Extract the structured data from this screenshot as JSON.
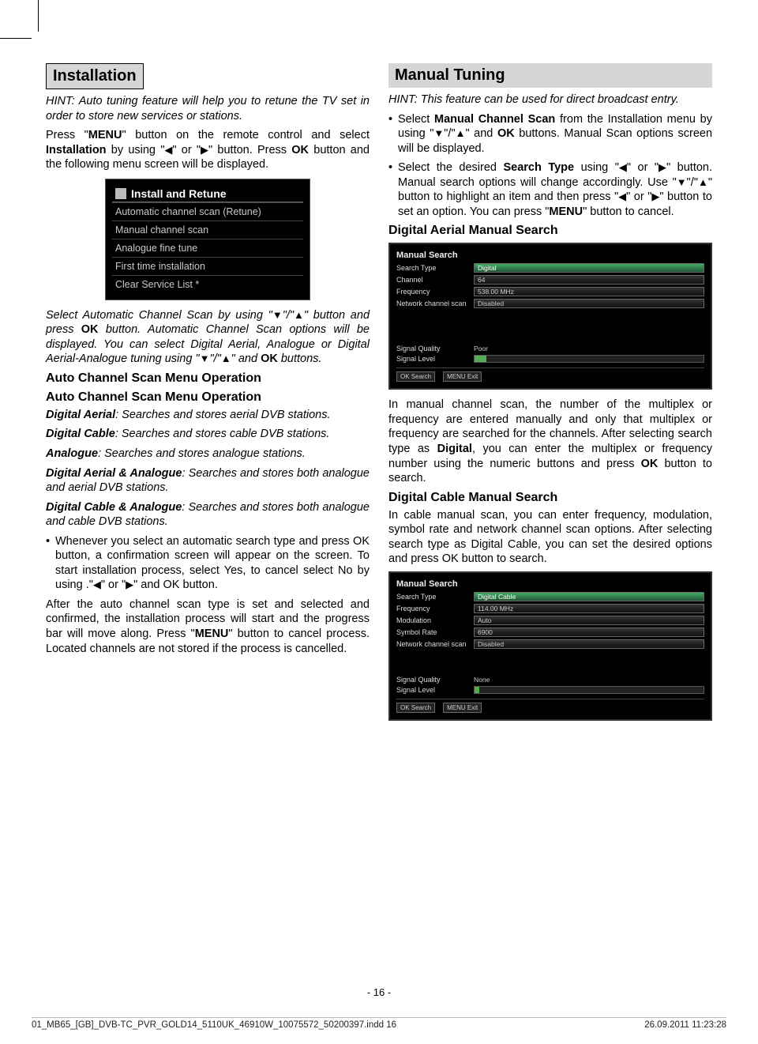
{
  "left": {
    "title": "Installation",
    "hint_pre": "HINT: Auto tuning feature will help you to retune the TV set in order to store new services or stations.",
    "p1_a": "Press \"",
    "p1_b": "MENU",
    "p1_c": "\" button on the remote control and select ",
    "p1_d": "Installation",
    "p1_e": " by using \"",
    "p1_f": "\" or \"",
    "p1_g": "\" button. Press ",
    "p1_h": "OK",
    "p1_i": " button and the following menu screen will be displayed.",
    "menu": {
      "title": "Install and Retune",
      "items": [
        "Automatic channel scan (Retune)",
        "Manual channel scan",
        "Analogue fine tune",
        "First time installation",
        "Clear Service List *"
      ]
    },
    "p2_a": "Select Automatic Channel Scan by using \"",
    "p2_b": "\"/\"",
    "p2_c": "\" button and press ",
    "p2_d": "OK",
    "p2_e": " button. Automatic Channel Scan options will be displayed. You can select Digital Aerial, Analogue or Digital Aerial-Analogue tuning using \"",
    "p2_f": "\"/\"",
    "p2_g": "\" and ",
    "p2_h": "OK",
    "p2_i": " buttons.",
    "sub1": "Auto Channel Scan Menu Operation",
    "sub2": "Auto Channel Scan Menu Operation",
    "da_l": "Digital Aerial",
    "da_t": ": Searches and stores aerial DVB stations.",
    "dc_l": "Digital Cable",
    "dc_t": ": Searches and stores cable DVB stations.",
    "an_l": "Analogue",
    "an_t": ": Searches and stores analogue stations.",
    "daa_l": "Digital Aerial & Analogue",
    "daa_t": ": Searches and stores both analogue and aerial DVB stations.",
    "dca_l": "Digital Cable & Analogue",
    "dca_t": ": Searches and stores both analogue and cable DVB stations.",
    "b1_a": "Whenever you select an automatic search type and press OK button, a confirmation screen will appear on the screen. To start installation process, select Yes, to cancel select No by using .\"",
    "b1_b": "\" or \"",
    "b1_c": "\" and OK button.",
    "p3_a": "After the auto channel scan type is set and selected and confirmed, the installation process will start and the progress bar will move along. Press \"",
    "p3_b": "MENU",
    "p3_c": "\" button to cancel process. Located channels are not stored if the process is cancelled."
  },
  "right": {
    "title": "Manual Tuning",
    "hint": "HINT: This feature can be used for direct broadcast entry.",
    "b1_a": "Select ",
    "b1_b": "Manual Channel Scan",
    "b1_c": " from the Installation menu by using \"",
    "b1_d": "\"/\"",
    "b1_e": "\" and ",
    "b1_f": "OK",
    "b1_g": " buttons. Manual Scan options screen will be displayed.",
    "b2_a": "Select the desired ",
    "b2_b": "Search Type",
    "b2_c": " using \"",
    "b2_d": "\" or \"",
    "b2_e": "\" button. Manual search options will change accordingly. Use \"",
    "b2_f": "\"/\"",
    "b2_g": "\" button to highlight an item and then press \"",
    "b2_h": "\" or \"",
    "b2_i": "\" button to set an option. You can press \"",
    "b2_j": "MENU",
    "b2_k": "\" button to cancel.",
    "sub_dams": "Digital Aerial Manual Search",
    "shot1": {
      "title": "Manual Search",
      "rows": [
        {
          "label": "Search Type",
          "value": "Digital",
          "sel": true
        },
        {
          "label": "Channel",
          "value": "64"
        },
        {
          "label": "Frequency",
          "value": "538.00 MHz"
        },
        {
          "label": "Network channel scan",
          "value": "Disabled"
        }
      ],
      "sig": [
        {
          "label": "Signal Quality",
          "value": "Poor"
        },
        {
          "label": "Signal Level",
          "value": ""
        }
      ],
      "foot": [
        "OK  Search",
        "MENU  Exit"
      ]
    },
    "p1": "In manual channel scan, the number of the multiplex or frequency are entered manually and only that multiplex or frequency are searched for the channels. After selecting search type as ",
    "p1b": "Digital",
    "p1c": ", you can enter the multiplex or frequency number using the numeric buttons and press ",
    "p1d": "OK",
    "p1e": " button to search.",
    "sub_dcms": "Digital Cable Manual Search",
    "p2": "In cable manual scan, you can enter frequency, modulation, symbol rate and network channel scan options. After selecting search type as Digital Cable, you can set the desired options and press OK button to search.",
    "shot2": {
      "title": "Manual Search",
      "rows": [
        {
          "label": "Search Type",
          "value": "Digital Cable",
          "sel": true
        },
        {
          "label": "Frequency",
          "value": "114.00 MHz"
        },
        {
          "label": "Modulation",
          "value": "Auto"
        },
        {
          "label": "Symbol Rate",
          "value": "6900"
        },
        {
          "label": "Network channel scan",
          "value": "Disabled"
        }
      ],
      "sig": [
        {
          "label": "Signal Quality",
          "value": "None"
        },
        {
          "label": "Signal Level",
          "value": ""
        }
      ],
      "foot": [
        "OK  Search",
        "MENU  Exit"
      ]
    }
  },
  "page_num": "- 16 -",
  "footer": {
    "left": "01_MB65_[GB]_DVB-TC_PVR_GOLD14_5110UK_46910W_10075572_50200397.indd   16",
    "right": "26.09.2011   11:23:28"
  },
  "arrows": {
    "left": "◀",
    "right": "▶",
    "up": "▲",
    "down": "▼"
  }
}
